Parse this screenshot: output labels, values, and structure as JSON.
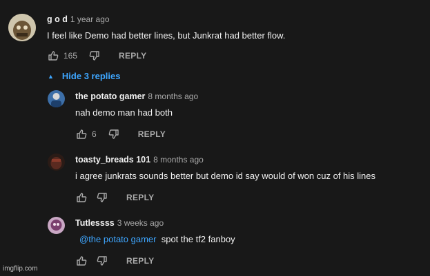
{
  "comment": {
    "author": "g o d",
    "time": "1 year ago",
    "text": "I feel like Demo had better lines, but Junkrat had better flow.",
    "likes": "165",
    "reply_label": "REPLY"
  },
  "replies_toggle": {
    "label": "Hide 3 replies"
  },
  "replies": [
    {
      "author": "the potato gamer",
      "time": "8 months ago",
      "text": "nah demo man had both",
      "likes": "6",
      "reply_label": "REPLY"
    },
    {
      "author": "toasty_breads 101",
      "time": "8 months ago",
      "text": "i agree junkrats sounds better but demo id say would of won cuz of his lines",
      "likes": "",
      "reply_label": "REPLY"
    },
    {
      "author": "Tutlessss",
      "time": "3 weeks ago",
      "mention": "@the potato gamer",
      "text": "spot the tf2 fanboy",
      "likes": "",
      "reply_label": "REPLY"
    }
  ],
  "watermark": "imgflip.com",
  "colors": {
    "background": "#181818",
    "link": "#3ea6ff",
    "muted": "#aaaaaa"
  }
}
